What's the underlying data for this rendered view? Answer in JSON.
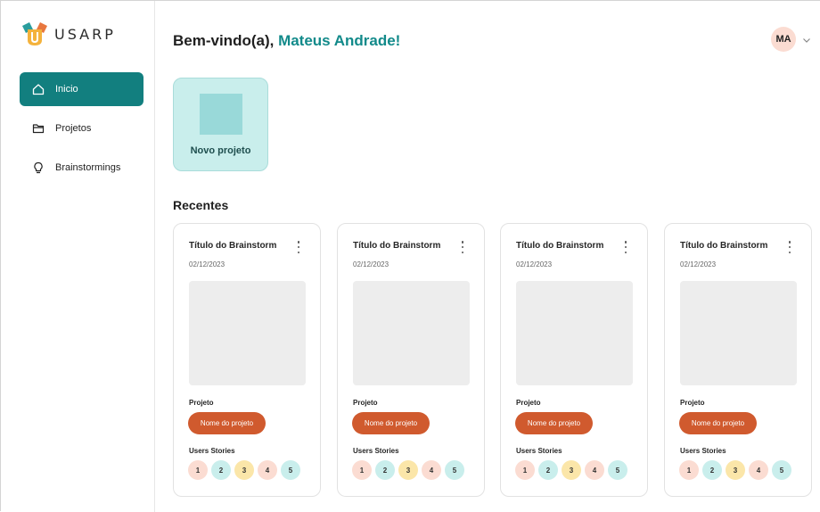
{
  "app": {
    "logo_text": "USARP"
  },
  "nav": {
    "items": [
      {
        "label": "Inicio",
        "icon": "home-icon",
        "active": true
      },
      {
        "label": "Projetos",
        "icon": "folder-icon",
        "active": false
      },
      {
        "label": "Brainstormings",
        "icon": "lightbulb-icon",
        "active": false
      }
    ]
  },
  "header": {
    "welcome_prefix": "Bem-vindo(a), ",
    "user_name": "Mateus Andrade!",
    "avatar_initials": "MA"
  },
  "new_project": {
    "label": "Novo projeto"
  },
  "recentes": {
    "title": "Recentes",
    "cards": [
      {
        "title": "Título do Brainstorm",
        "date": "02/12/2023",
        "project_label": "Projeto",
        "project_name": "Nome do projeto",
        "stories_label": "Users Stories",
        "stories": [
          "1",
          "2",
          "3",
          "4",
          "5"
        ]
      },
      {
        "title": "Título do Brainstorm",
        "date": "02/12/2023",
        "project_label": "Projeto",
        "project_name": "Nome do projeto",
        "stories_label": "Users Stories",
        "stories": [
          "1",
          "2",
          "3",
          "4",
          "5"
        ]
      },
      {
        "title": "Título do Brainstorm",
        "date": "02/12/2023",
        "project_label": "Projeto",
        "project_name": "Nome do projeto",
        "stories_label": "Users Stories",
        "stories": [
          "1",
          "2",
          "3",
          "4",
          "5"
        ]
      },
      {
        "title": "Título do Brainstorm",
        "date": "02/12/2023",
        "project_label": "Projeto",
        "project_name": "Nome do projeto",
        "stories_label": "Users Stories",
        "stories": [
          "1",
          "2",
          "3",
          "4",
          "5"
        ]
      }
    ]
  },
  "colors": {
    "primary": "#127f7f",
    "accent_text": "#128a8a",
    "chip": "#d05a2e",
    "new_project_bg": "#c9eeec"
  }
}
